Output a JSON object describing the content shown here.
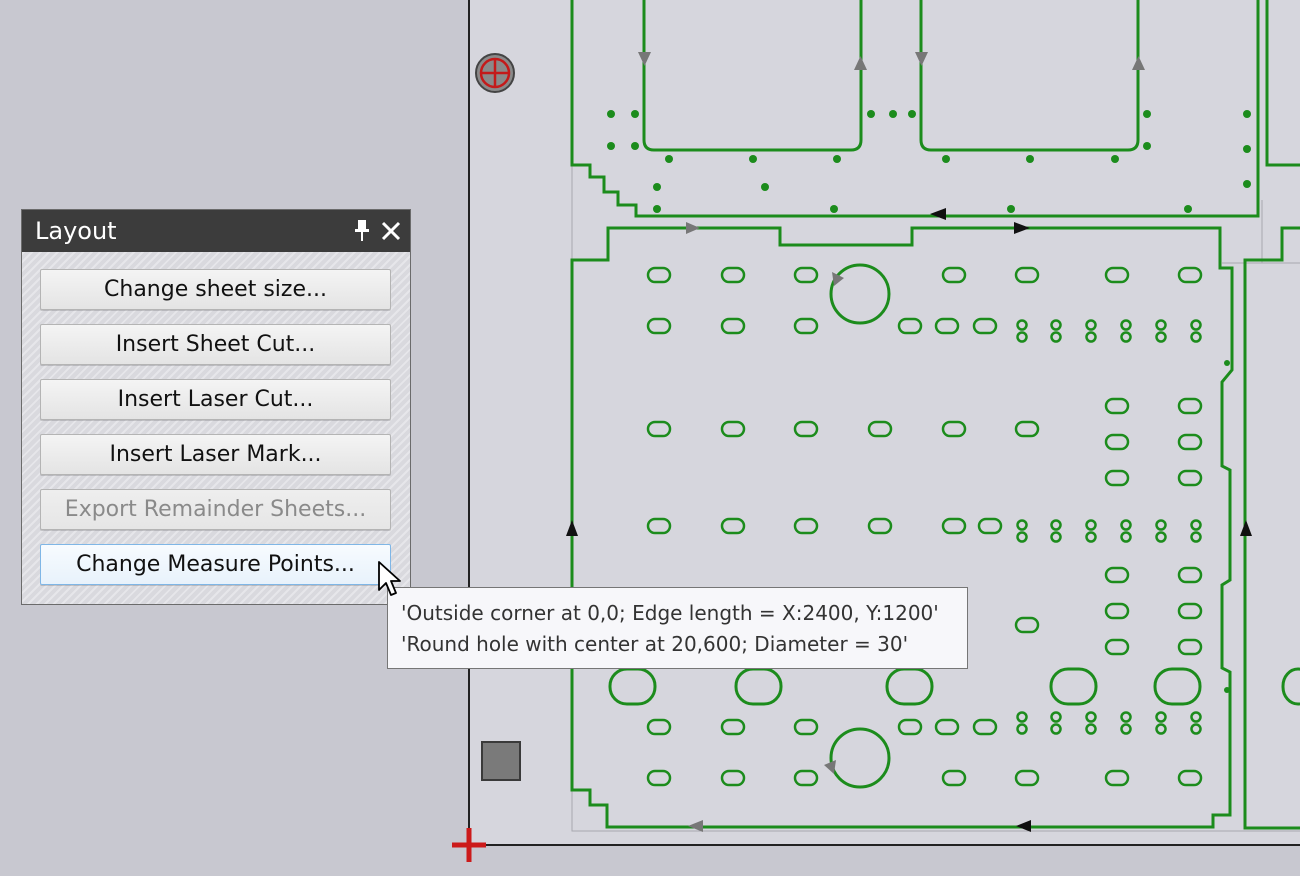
{
  "panel": {
    "title": "Layout",
    "buttons": {
      "change_sheet_size": "Change sheet size...",
      "insert_sheet_cut": "Insert Sheet Cut...",
      "insert_laser_cut": "Insert Laser Cut...",
      "insert_laser_mark": "Insert Laser Mark...",
      "export_remainder_sheets": "Export Remainder Sheets...",
      "change_measure_points": "Change Measure Points..."
    },
    "export_remainder_sheets_enabled": false,
    "hovered_button": "change_measure_points"
  },
  "tooltip": {
    "line1": "'Outside corner at 0,0; Edge length = X:2400, Y:1200'",
    "line2": "'Round hole with center at 20,600; Diameter = 30'"
  },
  "icons": {
    "pin": "pin-icon",
    "close": "close-icon",
    "measure_point_marker": "crosshair-icon",
    "origin_marker": "origin-cross-icon",
    "reference_square": "square-marker-icon",
    "cursor": "mouse-pointer-icon"
  },
  "colors": {
    "part_outline": "#1c8c1c",
    "sheet_background": "#d6d6dd",
    "workspace_background": "#c8c8d0",
    "origin_marker": "#cc1a1a",
    "panel_header": "#3c3c3c"
  }
}
